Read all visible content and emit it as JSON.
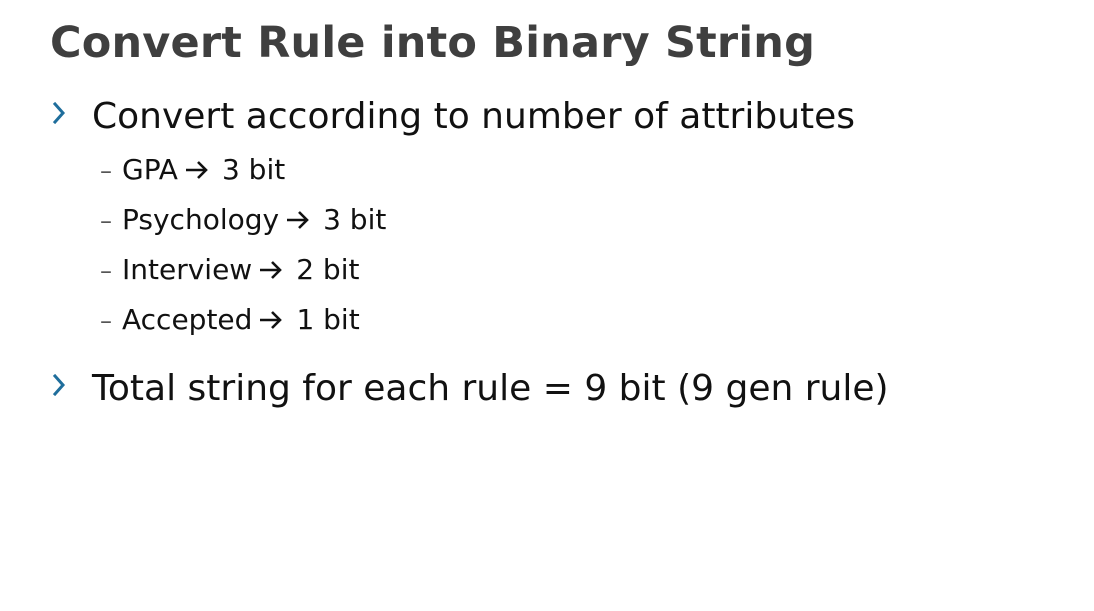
{
  "slide": {
    "title": "Convert Rule into Binary String",
    "accent_color": "#1f6e9c",
    "bullets": [
      {
        "text": "Convert according to number of attributes",
        "icon": "chevron-right-icon",
        "sub_items": [
          {
            "label": "GPA",
            "icon": "arrow-right-icon",
            "value": "3 bit"
          },
          {
            "label": "Psychology",
            "icon": "arrow-right-icon",
            "value": "3 bit"
          },
          {
            "label": "Interview",
            "icon": "arrow-right-icon",
            "value": "2 bit"
          },
          {
            "label": "Accepted",
            "icon": "arrow-right-icon",
            "value": "1 bit"
          }
        ]
      },
      {
        "text": "Total string for each rule = 9 bit (9 gen rule)",
        "icon": "chevron-right-icon"
      }
    ]
  }
}
